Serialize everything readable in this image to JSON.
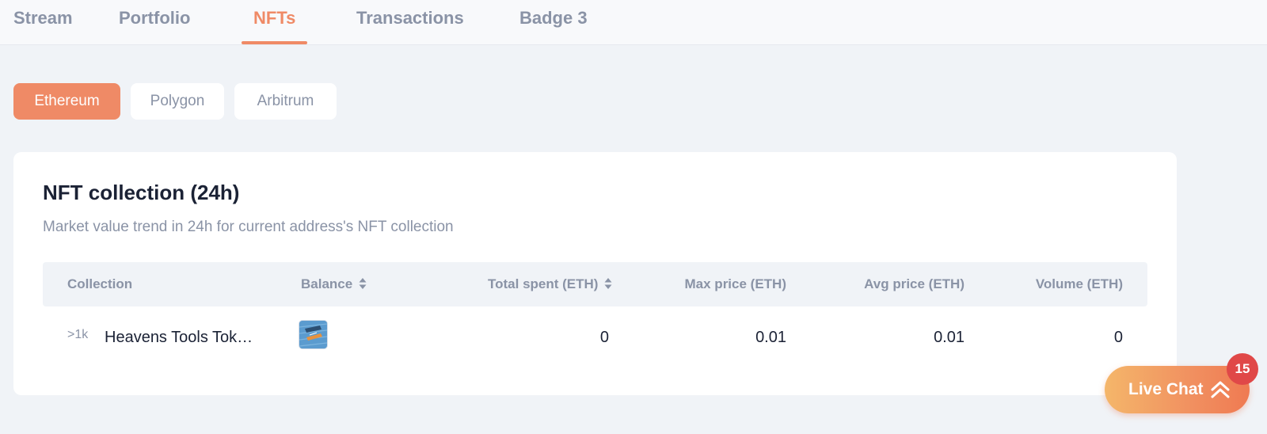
{
  "tabs": [
    {
      "label": "Stream"
    },
    {
      "label": "Portfolio"
    },
    {
      "label": "NFTs",
      "active": true
    },
    {
      "label": "Transactions"
    },
    {
      "label": "Badge 3"
    }
  ],
  "networks": [
    {
      "label": "Ethereum",
      "active": true
    },
    {
      "label": "Polygon"
    },
    {
      "label": "Arbitrum"
    }
  ],
  "card": {
    "title": "NFT collection (24h)",
    "subtitle": "Market value trend in 24h for current address's NFT collection",
    "columns": {
      "collection": "Collection",
      "balance": "Balance",
      "total_spent": "Total spent (ETH)",
      "max_price": "Max price (ETH)",
      "avg_price": "Avg price (ETH)",
      "volume": "Volume (ETH)"
    },
    "rows": [
      {
        "count": ">1k",
        "collection": "Heavens Tools Tok…",
        "total_spent": "0",
        "max_price": "0.01",
        "avg_price": "0.01",
        "volume": "0"
      }
    ]
  },
  "live_chat": {
    "label": "Live Chat",
    "badge": "15"
  },
  "colors": {
    "accent": "#ef8a66",
    "background": "#f0f3f7",
    "badge": "#e04848"
  },
  "icons": {
    "sort": "sort-icon",
    "chat_expand": "double-chevron-up-icon"
  }
}
